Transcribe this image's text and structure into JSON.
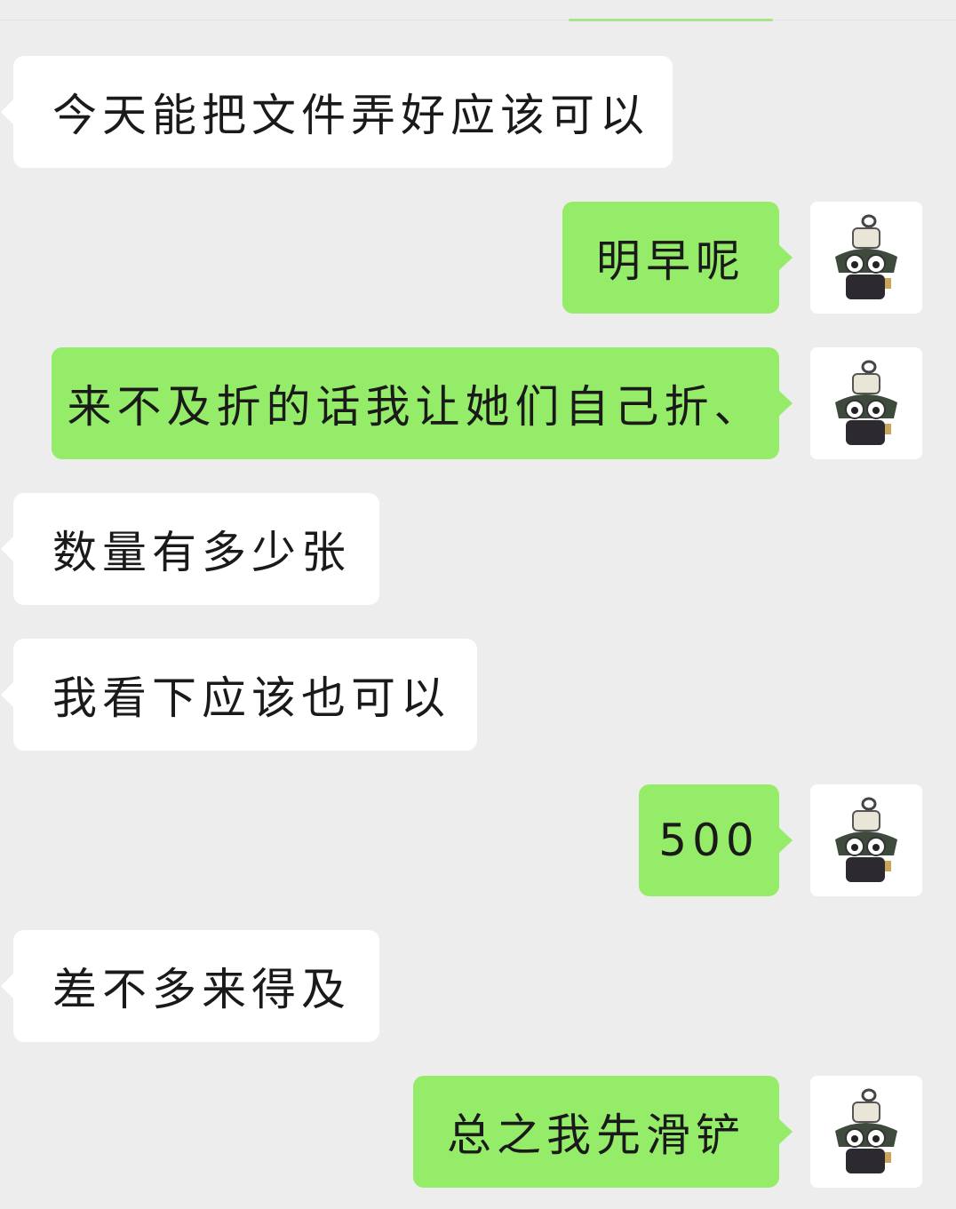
{
  "conversation": {
    "messages": [
      {
        "side": "in",
        "text": "今天能把文件弄好应该可以"
      },
      {
        "side": "out",
        "text": "明早呢"
      },
      {
        "side": "out",
        "text": "来不及折的话我让她们自己折、"
      },
      {
        "side": "in",
        "text": "数量有多少张"
      },
      {
        "side": "in",
        "text": "我看下应该也可以"
      },
      {
        "side": "out",
        "text": "500"
      },
      {
        "side": "in",
        "text": "差不多来得及"
      },
      {
        "side": "out",
        "text": "总之我先滑铲"
      }
    ]
  },
  "colors": {
    "background": "#ededed",
    "incoming_bubble": "#ffffff",
    "outgoing_bubble": "#95ec69"
  },
  "icons": {
    "avatar": "avatar-icon"
  }
}
